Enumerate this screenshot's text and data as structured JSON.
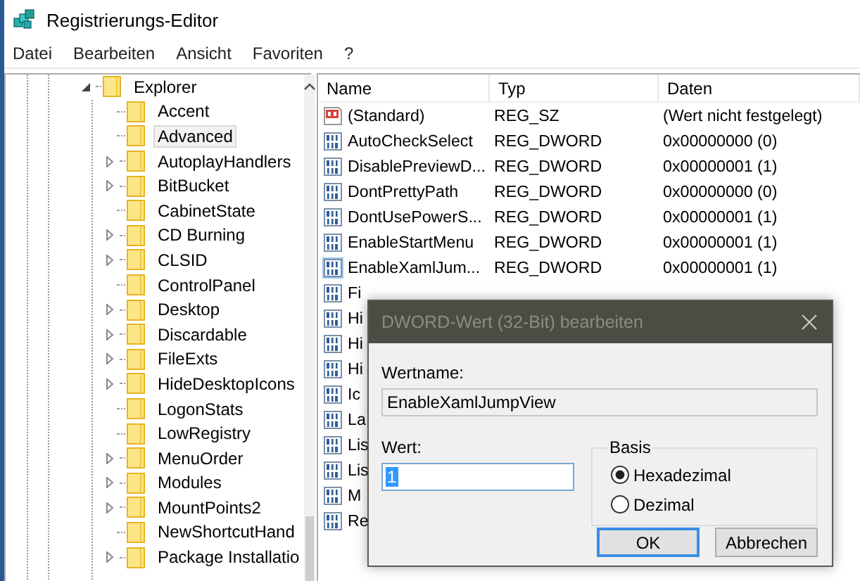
{
  "window": {
    "title": "Registrierungs-Editor"
  },
  "menu": [
    "Datei",
    "Bearbeiten",
    "Ansicht",
    "Favoriten",
    "?"
  ],
  "tree": {
    "label": "Explorer",
    "expanded": true,
    "children": [
      {
        "label": "Accent",
        "expandable": false,
        "selected": false
      },
      {
        "label": "Advanced",
        "expandable": false,
        "selected": true
      },
      {
        "label": "AutoplayHandlers",
        "expandable": true,
        "selected": false
      },
      {
        "label": "BitBucket",
        "expandable": true,
        "selected": false
      },
      {
        "label": "CabinetState",
        "expandable": false,
        "selected": false
      },
      {
        "label": "CD Burning",
        "expandable": true,
        "selected": false
      },
      {
        "label": "CLSID",
        "expandable": true,
        "selected": false
      },
      {
        "label": "ControlPanel",
        "expandable": false,
        "selected": false
      },
      {
        "label": "Desktop",
        "expandable": true,
        "selected": false
      },
      {
        "label": "Discardable",
        "expandable": true,
        "selected": false
      },
      {
        "label": "FileExts",
        "expandable": true,
        "selected": false
      },
      {
        "label": "HideDesktopIcons",
        "expandable": true,
        "selected": false
      },
      {
        "label": "LogonStats",
        "expandable": false,
        "selected": false
      },
      {
        "label": "LowRegistry",
        "expandable": false,
        "selected": false
      },
      {
        "label": "MenuOrder",
        "expandable": true,
        "selected": false
      },
      {
        "label": "Modules",
        "expandable": true,
        "selected": false
      },
      {
        "label": "MountPoints2",
        "expandable": true,
        "selected": false
      },
      {
        "label": "NewShortcutHand",
        "expandable": false,
        "selected": false
      },
      {
        "label": "Package Installatio",
        "expandable": true,
        "selected": false
      }
    ]
  },
  "list": {
    "columns": [
      "Name",
      "Typ",
      "Daten"
    ],
    "rows": [
      {
        "kind": "string",
        "name": "(Standard)",
        "type": "REG_SZ",
        "data": "(Wert nicht festgelegt)",
        "selected": false
      },
      {
        "kind": "dword",
        "name": "AutoCheckSelect",
        "type": "REG_DWORD",
        "data": "0x00000000 (0)",
        "selected": false
      },
      {
        "kind": "dword",
        "name": "DisablePreviewD...",
        "type": "REG_DWORD",
        "data": "0x00000001 (1)",
        "selected": false
      },
      {
        "kind": "dword",
        "name": "DontPrettyPath",
        "type": "REG_DWORD",
        "data": "0x00000000 (0)",
        "selected": false
      },
      {
        "kind": "dword",
        "name": "DontUsePowerS...",
        "type": "REG_DWORD",
        "data": "0x00000001 (1)",
        "selected": false
      },
      {
        "kind": "dword",
        "name": "EnableStartMenu",
        "type": "REG_DWORD",
        "data": "0x00000001 (1)",
        "selected": false
      },
      {
        "kind": "dword",
        "name": "EnableXamlJum...",
        "type": "REG_DWORD",
        "data": "0x00000001 (1)",
        "selected": true
      },
      {
        "kind": "dword",
        "name": "Fi",
        "selected": false
      },
      {
        "kind": "dword",
        "name": "Hi",
        "selected": false
      },
      {
        "kind": "dword",
        "name": "Hi",
        "selected": false
      },
      {
        "kind": "dword",
        "name": "Hi",
        "selected": false
      },
      {
        "kind": "dword",
        "name": "Ic",
        "selected": false
      },
      {
        "kind": "dword",
        "name": "La",
        "selected": false
      },
      {
        "kind": "dword",
        "name": "Lis",
        "selected": false
      },
      {
        "kind": "dword",
        "name": "Lis",
        "selected": false
      },
      {
        "kind": "dword",
        "name": "M",
        "selected": false
      },
      {
        "kind": "dword",
        "name": "Re",
        "selected": false
      }
    ]
  },
  "dialog": {
    "title": "DWORD-Wert (32-Bit) bearbeiten",
    "name_label": "Wertname:",
    "name_value": "EnableXamlJumpView",
    "value_label": "Wert:",
    "value": "1",
    "base_label": "Basis",
    "bases": [
      {
        "label": "Hexadezimal",
        "selected": true
      },
      {
        "label": "Dezimal",
        "selected": false
      }
    ],
    "buttons": [
      {
        "label": "OK",
        "default": true
      },
      {
        "label": "Abbrechen",
        "default": false
      }
    ]
  }
}
